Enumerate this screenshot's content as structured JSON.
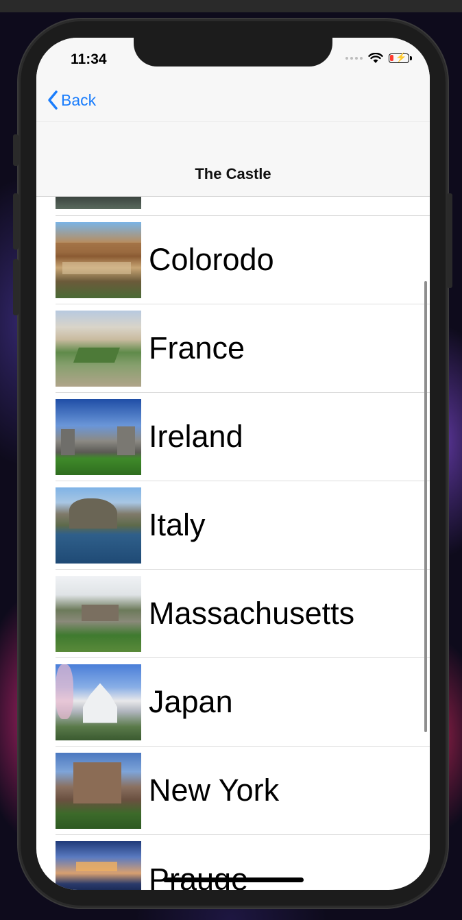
{
  "status_bar": {
    "time": "11:34"
  },
  "nav": {
    "back_label": "Back",
    "title": "The Castle"
  },
  "rows": [
    {
      "label": "",
      "image": "castle-photo"
    },
    {
      "label": "Colorodo",
      "image": "cliff-dwelling-photo"
    },
    {
      "label": "France",
      "image": "palace-garden-photo"
    },
    {
      "label": "Ireland",
      "image": "castle-lawn-photo"
    },
    {
      "label": "Italy",
      "image": "island-castle-harbor-photo"
    },
    {
      "label": "Massachusetts",
      "image": "mansion-lawn-photo"
    },
    {
      "label": "Japan",
      "image": "japanese-castle-photo"
    },
    {
      "label": "New York",
      "image": "castle-ruin-photo"
    },
    {
      "label": "Prauge",
      "image": "prague-castle-night-photo"
    }
  ]
}
